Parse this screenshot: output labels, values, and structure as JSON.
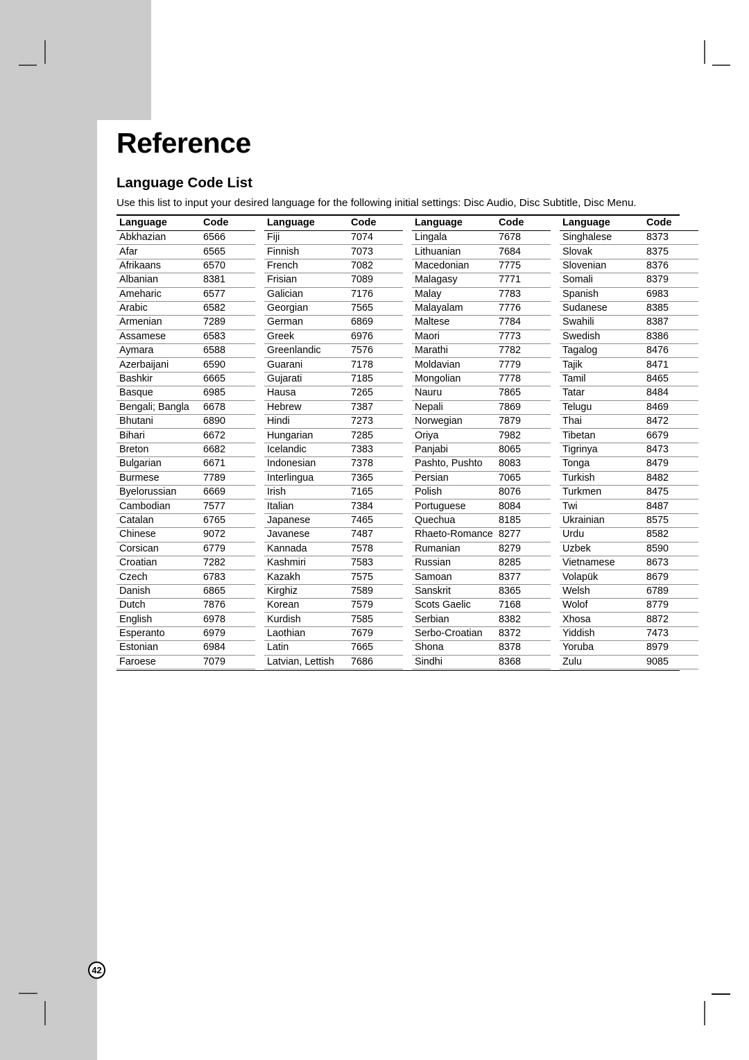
{
  "page": {
    "title": "Reference",
    "section_title": "Language Code List",
    "intro": "Use this list to input your desired language for the following initial settings: Disc Audio, Disc Subtitle, Disc Menu.",
    "page_number": "42",
    "background_color": "#ffffff",
    "bleed_color": "#cbcbcb",
    "rule_color": "#000000"
  },
  "table": {
    "headers": {
      "language": "Language",
      "code": "Code"
    },
    "column_count": 4,
    "rows_per_column": 31,
    "columns": [
      {
        "index": 1,
        "rows": [
          {
            "language": "Abkhazian",
            "code": "6566"
          },
          {
            "language": "Afar",
            "code": "6565"
          },
          {
            "language": "Afrikaans",
            "code": "6570"
          },
          {
            "language": "Albanian",
            "code": "8381"
          },
          {
            "language": "Ameharic",
            "code": "6577"
          },
          {
            "language": "Arabic",
            "code": "6582"
          },
          {
            "language": "Armenian",
            "code": "7289"
          },
          {
            "language": "Assamese",
            "code": "6583"
          },
          {
            "language": "Aymara",
            "code": "6588"
          },
          {
            "language": "Azerbaijani",
            "code": "6590"
          },
          {
            "language": "Bashkir",
            "code": "6665"
          },
          {
            "language": "Basque",
            "code": "6985"
          },
          {
            "language": "Bengali; Bangla",
            "code": "6678"
          },
          {
            "language": "Bhutani",
            "code": "6890"
          },
          {
            "language": "Bihari",
            "code": "6672"
          },
          {
            "language": "Breton",
            "code": "6682"
          },
          {
            "language": "Bulgarian",
            "code": "6671"
          },
          {
            "language": "Burmese",
            "code": "7789"
          },
          {
            "language": "Byelorussian",
            "code": "6669"
          },
          {
            "language": "Cambodian",
            "code": "7577"
          },
          {
            "language": "Catalan",
            "code": "6765"
          },
          {
            "language": "Chinese",
            "code": "9072"
          },
          {
            "language": "Corsican",
            "code": "6779"
          },
          {
            "language": "Croatian",
            "code": "7282"
          },
          {
            "language": "Czech",
            "code": "6783"
          },
          {
            "language": "Danish",
            "code": "6865"
          },
          {
            "language": "Dutch",
            "code": "7876"
          },
          {
            "language": "English",
            "code": "6978"
          },
          {
            "language": "Esperanto",
            "code": "6979"
          },
          {
            "language": "Estonian",
            "code": "6984"
          },
          {
            "language": "Faroese",
            "code": "7079"
          }
        ]
      },
      {
        "index": 2,
        "rows": [
          {
            "language": "Fiji",
            "code": "7074"
          },
          {
            "language": "Finnish",
            "code": "7073"
          },
          {
            "language": "French",
            "code": "7082"
          },
          {
            "language": "Frisian",
            "code": "7089"
          },
          {
            "language": "Galician",
            "code": "7176"
          },
          {
            "language": "Georgian",
            "code": "7565"
          },
          {
            "language": "German",
            "code": "6869"
          },
          {
            "language": "Greek",
            "code": "6976"
          },
          {
            "language": "Greenlandic",
            "code": "7576"
          },
          {
            "language": "Guarani",
            "code": "7178"
          },
          {
            "language": "Gujarati",
            "code": "7185"
          },
          {
            "language": "Hausa",
            "code": "7265"
          },
          {
            "language": "Hebrew",
            "code": "7387"
          },
          {
            "language": "Hindi",
            "code": "7273"
          },
          {
            "language": "Hungarian",
            "code": "7285"
          },
          {
            "language": "Icelandic",
            "code": "7383"
          },
          {
            "language": "Indonesian",
            "code": "7378"
          },
          {
            "language": "Interlingua",
            "code": "7365"
          },
          {
            "language": "Irish",
            "code": "7165"
          },
          {
            "language": "Italian",
            "code": "7384"
          },
          {
            "language": "Japanese",
            "code": "7465"
          },
          {
            "language": "Javanese",
            "code": "7487"
          },
          {
            "language": "Kannada",
            "code": "7578"
          },
          {
            "language": "Kashmiri",
            "code": "7583"
          },
          {
            "language": "Kazakh",
            "code": "7575"
          },
          {
            "language": "Kirghiz",
            "code": "7589"
          },
          {
            "language": "Korean",
            "code": "7579"
          },
          {
            "language": "Kurdish",
            "code": "7585"
          },
          {
            "language": "Laothian",
            "code": "7679"
          },
          {
            "language": "Latin",
            "code": "7665"
          },
          {
            "language": "Latvian, Lettish",
            "code": "7686"
          }
        ]
      },
      {
        "index": 3,
        "rows": [
          {
            "language": "Lingala",
            "code": "7678"
          },
          {
            "language": "Lithuanian",
            "code": "7684"
          },
          {
            "language": "Macedonian",
            "code": "7775"
          },
          {
            "language": "Malagasy",
            "code": "7771"
          },
          {
            "language": "Malay",
            "code": "7783"
          },
          {
            "language": "Malayalam",
            "code": "7776"
          },
          {
            "language": "Maltese",
            "code": "7784"
          },
          {
            "language": "Maori",
            "code": "7773"
          },
          {
            "language": "Marathi",
            "code": "7782"
          },
          {
            "language": "Moldavian",
            "code": "7779"
          },
          {
            "language": "Mongolian",
            "code": "7778"
          },
          {
            "language": "Nauru",
            "code": "7865"
          },
          {
            "language": "Nepali",
            "code": "7869"
          },
          {
            "language": "Norwegian",
            "code": "7879"
          },
          {
            "language": "Oriya",
            "code": "7982"
          },
          {
            "language": "Panjabi",
            "code": "8065"
          },
          {
            "language": "Pashto, Pushto",
            "code": "8083"
          },
          {
            "language": "Persian",
            "code": "7065"
          },
          {
            "language": "Polish",
            "code": "8076"
          },
          {
            "language": "Portuguese",
            "code": "8084"
          },
          {
            "language": "Quechua",
            "code": "8185"
          },
          {
            "language": "Rhaeto-Romance",
            "code": "8277"
          },
          {
            "language": "Rumanian",
            "code": "8279"
          },
          {
            "language": "Russian",
            "code": "8285"
          },
          {
            "language": "Samoan",
            "code": "8377"
          },
          {
            "language": "Sanskrit",
            "code": "8365"
          },
          {
            "language": "Scots Gaelic",
            "code": "7168"
          },
          {
            "language": "Serbian",
            "code": "8382"
          },
          {
            "language": "Serbo-Croatian",
            "code": "8372"
          },
          {
            "language": "Shona",
            "code": "8378"
          },
          {
            "language": "Sindhi",
            "code": "8368"
          }
        ]
      },
      {
        "index": 4,
        "rows": [
          {
            "language": "Singhalese",
            "code": "8373"
          },
          {
            "language": "Slovak",
            "code": "8375"
          },
          {
            "language": "Slovenian",
            "code": "8376"
          },
          {
            "language": "Somali",
            "code": "8379"
          },
          {
            "language": "Spanish",
            "code": "6983"
          },
          {
            "language": "Sudanese",
            "code": "8385"
          },
          {
            "language": "Swahili",
            "code": "8387"
          },
          {
            "language": "Swedish",
            "code": "8386"
          },
          {
            "language": "Tagalog",
            "code": "8476"
          },
          {
            "language": "Tajik",
            "code": "8471"
          },
          {
            "language": "Tamil",
            "code": "8465"
          },
          {
            "language": "Tatar",
            "code": "8484"
          },
          {
            "language": "Telugu",
            "code": "8469"
          },
          {
            "language": "Thai",
            "code": "8472"
          },
          {
            "language": "Tibetan",
            "code": "6679"
          },
          {
            "language": "Tigrinya",
            "code": "8473"
          },
          {
            "language": "Tonga",
            "code": "8479"
          },
          {
            "language": "Turkish",
            "code": "8482"
          },
          {
            "language": "Turkmen",
            "code": "8475"
          },
          {
            "language": "Twi",
            "code": "8487"
          },
          {
            "language": "Ukrainian",
            "code": "8575"
          },
          {
            "language": "Urdu",
            "code": "8582"
          },
          {
            "language": "Uzbek",
            "code": "8590"
          },
          {
            "language": "Vietnamese",
            "code": "8673"
          },
          {
            "language": "Volapük",
            "code": "8679"
          },
          {
            "language": "Welsh",
            "code": "6789"
          },
          {
            "language": "Wolof",
            "code": "8779"
          },
          {
            "language": "Xhosa",
            "code": "8872"
          },
          {
            "language": "Yiddish",
            "code": "7473"
          },
          {
            "language": "Yoruba",
            "code": "8979"
          },
          {
            "language": "Zulu",
            "code": "9085"
          }
        ]
      }
    ]
  }
}
